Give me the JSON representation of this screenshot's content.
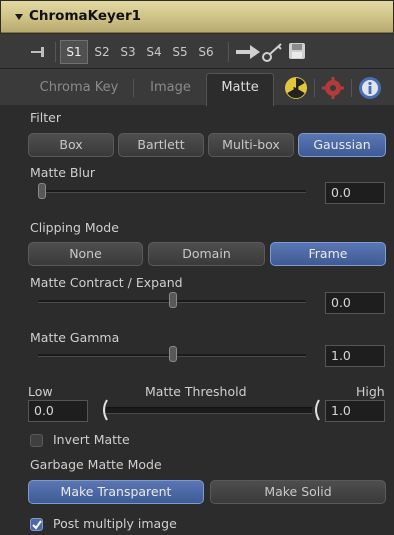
{
  "header": {
    "title": "ChromaKeyer1"
  },
  "versions": [
    "S1",
    "S2",
    "S3",
    "S4",
    "S5",
    "S6"
  ],
  "tabs": {
    "chroma_key": "Chroma Key",
    "image": "Image",
    "matte": "Matte"
  },
  "filter": {
    "label": "Filter",
    "options": [
      "Box",
      "Bartlett",
      "Multi-box",
      "Gaussian"
    ],
    "selected": "Gaussian"
  },
  "matte_blur": {
    "label": "Matte Blur",
    "value": "0.0"
  },
  "clipping": {
    "label": "Clipping Mode",
    "options": [
      "None",
      "Domain",
      "Frame"
    ],
    "selected": "Frame"
  },
  "contract": {
    "label": "Matte Contract / Expand",
    "value": "0.0"
  },
  "gamma": {
    "label": "Matte Gamma",
    "value": "1.0"
  },
  "threshold": {
    "label": "Matte Threshold",
    "low_label": "Low",
    "high_label": "High",
    "low_value": "0.0",
    "high_value": "1.0"
  },
  "invert": {
    "label": "Invert Matte",
    "checked": false
  },
  "garbage": {
    "label": "Garbage Matte Mode",
    "options": [
      "Make Transparent",
      "Make Solid"
    ],
    "selected": "Make Transparent"
  },
  "post_multiply": {
    "label": "Post multiply image",
    "checked": true
  },
  "colors": {
    "accent": "#4e6aa6",
    "header": "#cfc286",
    "background": "#2c2c2c"
  }
}
